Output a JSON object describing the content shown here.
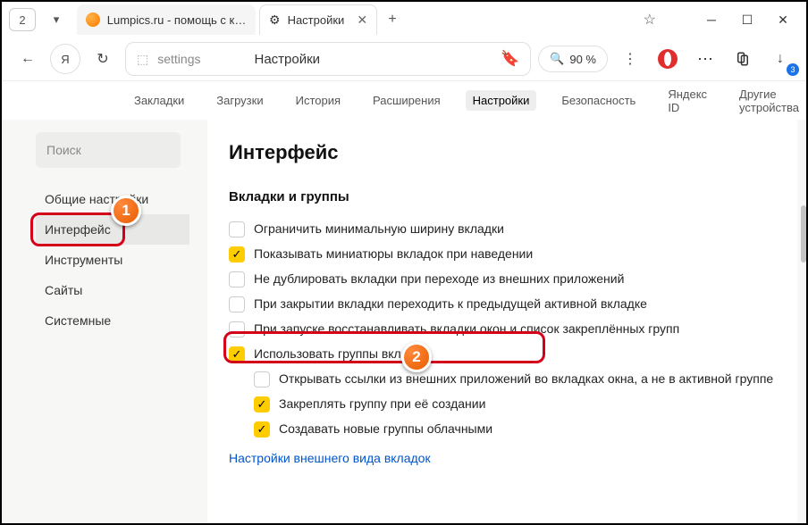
{
  "tabs": {
    "counter": "2",
    "tab0_title": "Lumpics.ru - помощь с ком",
    "tab1_title": "Настройки"
  },
  "toolbar": {
    "addr_text": "settings",
    "addr_label": "Настройки",
    "zoom": "90 %",
    "download_badge": "3"
  },
  "nav": {
    "items": [
      "Закладки",
      "Загрузки",
      "История",
      "Расширения",
      "Настройки",
      "Безопасность",
      "Яндекс ID",
      "Другие устройства"
    ]
  },
  "sidebar": {
    "search_placeholder": "Поиск",
    "items": [
      "Общие настройки",
      "Интерфейс",
      "Инструменты",
      "Сайты",
      "Системные"
    ]
  },
  "main": {
    "heading": "Интерфейс",
    "section": "Вкладки и группы",
    "opts": [
      {
        "label": "Ограничить минимальную ширину вкладки",
        "checked": false,
        "indent": false
      },
      {
        "label": "Показывать миниатюры вкладок при наведении",
        "checked": true,
        "indent": false
      },
      {
        "label": "Не дублировать вкладки при переходе из внешних приложений",
        "checked": false,
        "indent": false
      },
      {
        "label": "При закрытии вкладки переходить к предыдущей активной вкладке",
        "checked": false,
        "indent": false
      },
      {
        "label": "При запуске восстанавливать вкладки окон и список закреплённых групп",
        "checked": false,
        "indent": false
      },
      {
        "label": "Использовать группы вкладок",
        "checked": true,
        "indent": false
      },
      {
        "label": "Открывать ссылки из внешних приложений во вкладках окна, а не в активной группе",
        "checked": false,
        "indent": true
      },
      {
        "label": "Закреплять группу при её создании",
        "checked": true,
        "indent": true
      },
      {
        "label": "Создавать новые группы облачными",
        "checked": true,
        "indent": true
      }
    ],
    "link": "Настройки внешнего вида вкладок"
  },
  "annotations": {
    "a1": "1",
    "a2": "2"
  }
}
